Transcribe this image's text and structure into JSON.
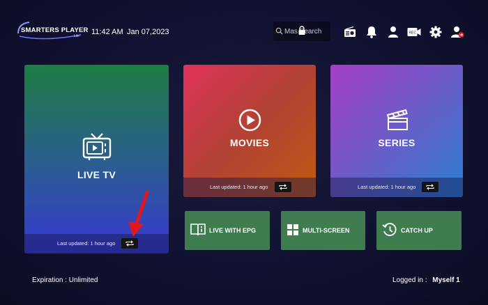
{
  "header": {
    "logo_text": "SMARTERS PLAYER",
    "logo_sub": "Lite",
    "time": "11:42 AM",
    "date": "Jan 07,2023",
    "search_placeholder": "Master Search",
    "search_visible": "Mas    Search",
    "icons": [
      "radio-icon",
      "bell-icon",
      "user-icon",
      "video-record-icon",
      "gear-icon",
      "switch-user-icon"
    ]
  },
  "cards": {
    "live": {
      "title": "LIVE TV",
      "last_updated": "Last updated: 1 hour ago"
    },
    "movies": {
      "title": "MOVIES",
      "last_updated": "Last updated: 1 hour ago"
    },
    "series": {
      "title": "SERIES",
      "last_updated": "Last updated: 1 hour ago"
    }
  },
  "buttons": {
    "epg": "LIVE WITH EPG",
    "multiscreen": "MULTI-SCREEN",
    "catchup": "CATCH UP"
  },
  "footer": {
    "expiration": "Expiration : Unlimited",
    "logged_in_label": "Logged in :",
    "logged_in_user": "Myself 1"
  },
  "colors": {
    "accent_arrow": "#e0171d",
    "button_green": "#3f7c50"
  }
}
